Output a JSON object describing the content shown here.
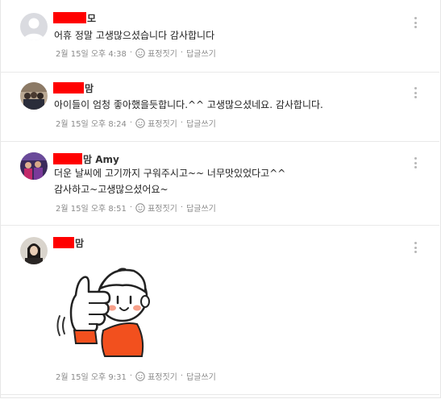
{
  "comments": [
    {
      "name_suffix": "모",
      "text_lines": [
        "어휴 정말 고생많으셨습니다 감사합니다"
      ],
      "date": "2월 15일 오후 4:38",
      "react_label": "표정짓기",
      "reply_label": "답글쓰기"
    },
    {
      "name_suffix": "맘",
      "text_lines": [
        "아이들이 엄청 좋아했을듯합니다.^^ 고생많으셨네요. 감사합니다."
      ],
      "date": "2월 15일 오후 8:24",
      "react_label": "표정짓기",
      "reply_label": "답글쓰기"
    },
    {
      "name_suffix": "맘 Amy",
      "text_lines": [
        "더운 날씨에 고기까지 구워주시고~~ 너무맛있었다고^^",
        "감사하고~고생많으셨어요~"
      ],
      "date": "2월 15일 오후 8:51",
      "react_label": "표정짓기",
      "reply_label": "답글쓰기"
    },
    {
      "name_suffix": "맘",
      "text_lines": [],
      "date": "2월 15일 오후 9:31",
      "react_label": "표정짓기",
      "reply_label": "답글쓰기"
    }
  ],
  "meta_separator": "·",
  "colors": {
    "redaction": "#ff0000",
    "meta_text": "#8a8a8a",
    "sticker_shirt": "#f2501e"
  }
}
